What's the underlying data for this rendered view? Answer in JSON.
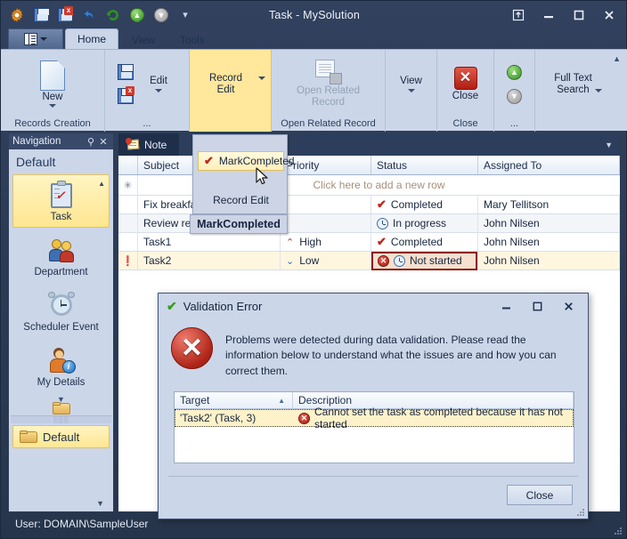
{
  "window": {
    "title": "Task - MySolution",
    "quick_access": [
      {
        "name": "app-gear-icon",
        "label": "Options"
      },
      {
        "name": "save-icon",
        "label": "Save"
      },
      {
        "name": "save-close-icon",
        "label": "Save and Close"
      },
      {
        "name": "undo-icon",
        "label": "Undo"
      },
      {
        "name": "refresh-icon",
        "label": "Refresh"
      },
      {
        "name": "next-record-icon",
        "label": "Next Record"
      },
      {
        "name": "previous-record-icon",
        "label": "Previous Record"
      },
      {
        "name": "customize-qat-icon",
        "label": "Customize Quick Access Toolbar"
      }
    ],
    "controls": {
      "restore_layout": "Restore",
      "minimize": "Minimize",
      "maximize": "Maximize",
      "close": "Close"
    }
  },
  "ribbon": {
    "app_menu_label": "File",
    "tabs": [
      {
        "label": "Home",
        "active": true
      },
      {
        "label": "View",
        "active": false
      },
      {
        "label": "Tools",
        "active": false
      }
    ],
    "collapse_label": "Minimize the Ribbon",
    "groups": [
      {
        "title": "Records Creation",
        "buttons": [
          {
            "label": "New",
            "icon": "new-document-icon",
            "has_caret": true,
            "disabled": false
          }
        ]
      },
      {
        "title": "...",
        "buttons": [
          {
            "label": "Save",
            "icon": "save-icon",
            "has_caret": false,
            "disabled": false
          },
          {
            "label": "Save and Close",
            "icon": "save-close-icon",
            "has_caret": false,
            "disabled": false
          },
          {
            "label": "Edit",
            "icon": "",
            "has_caret": true,
            "disabled": false
          }
        ]
      },
      {
        "title": "",
        "highlighted": true,
        "buttons": [
          {
            "label": "Record\nEdit",
            "icon": "",
            "has_caret": true,
            "disabled": false
          }
        ]
      },
      {
        "title": "Open Related Record",
        "buttons": [
          {
            "label": "Open Related\nRecord",
            "icon": "open-related-record-icon",
            "has_caret": false,
            "disabled": true
          }
        ]
      },
      {
        "title": "",
        "buttons": [
          {
            "label": "View",
            "icon": "",
            "has_caret": true,
            "disabled": false
          }
        ]
      },
      {
        "title": "Close",
        "buttons": [
          {
            "label": "Close",
            "icon": "close-record-icon",
            "has_caret": false,
            "disabled": false
          }
        ]
      },
      {
        "title": "...",
        "buttons": [
          {
            "label": "",
            "icon": "up-arrow-green-icon",
            "has_caret": false,
            "disabled": false
          },
          {
            "label": "",
            "icon": "down-arrow-gray-icon",
            "has_caret": false,
            "disabled": true
          }
        ]
      },
      {
        "title": "",
        "buttons": [
          {
            "label": "Full Text\nSearch",
            "icon": "",
            "has_caret": true,
            "disabled": false
          }
        ]
      }
    ]
  },
  "navigation": {
    "caption": "Navigation",
    "pin_icon": "pin-icon",
    "close_icon": "close-icon",
    "group_title": "Default",
    "items": [
      {
        "label": "Task",
        "icon": "clipboard-task-icon",
        "selected": true
      },
      {
        "label": "Department",
        "icon": "people-icon",
        "selected": false
      },
      {
        "label": "Scheduler Event",
        "icon": "alarm-clock-icon",
        "selected": false
      },
      {
        "label": "My Details",
        "icon": "person-info-icon",
        "selected": false
      }
    ],
    "scroll_down_label": "Scroll Down",
    "group_button": {
      "label": "Default",
      "icon": "folder-icon"
    },
    "configure_label": "Configure buttons"
  },
  "document": {
    "tab_label": "Note",
    "tab_icon": "note-icon",
    "tab_menu_icon": "chevron-down-icon"
  },
  "grid": {
    "columns": [
      "Subject",
      "Priority",
      "Status",
      "Assigned To"
    ],
    "new_row_text": "Click here to add a new row",
    "new_row_indicator": "new-row-asterisk-icon",
    "rows": [
      {
        "indicator": "",
        "subject": "Fix breakfast",
        "priority": "",
        "priority_icon": "",
        "status": "Completed",
        "status_icon": "check-icon",
        "assigned_to": "Mary Tellitson",
        "selected": false,
        "error": false
      },
      {
        "indicator": "",
        "subject": "Review report",
        "priority": "",
        "priority_icon": "",
        "status": "In progress",
        "status_icon": "clock-icon",
        "assigned_to": "John Nilsen",
        "selected": false,
        "error": false
      },
      {
        "indicator": "",
        "subject": "Task1",
        "priority": "High",
        "priority_icon": "arrow-up-icon",
        "status": "Completed",
        "status_icon": "check-icon",
        "assigned_to": "John Nilsen",
        "selected": false,
        "error": false
      },
      {
        "indicator": "warning-icon",
        "subject": "Task2",
        "priority": "Low",
        "priority_icon": "arrow-down-icon",
        "status": "Not started",
        "status_icon": "clock-icon",
        "status_error_icon": "error-icon",
        "assigned_to": "John Nilsen",
        "selected": true,
        "error": true
      }
    ]
  },
  "dropdown_menu": {
    "items": [
      {
        "label": "MarkCompleted",
        "icon": "check-icon",
        "highlighted": true
      },
      {
        "label": "Record Edit",
        "icon": "",
        "highlighted": false
      }
    ],
    "tooltip": "MarkCompleted"
  },
  "dialog": {
    "title": "Validation Error",
    "title_icon": "green-check-icon",
    "error_icon": "error-circle-icon",
    "message": "Problems were detected during data validation. Please read the information below to understand what the issues are and how you can correct them.",
    "controls": {
      "minimize": "Minimize",
      "maximize": "Maximize",
      "close": "Close"
    },
    "list": {
      "columns": [
        "Target",
        "Description"
      ],
      "sort_column": "Target",
      "sort_direction": "asc",
      "rows": [
        {
          "target": "'Task2' (Task, 3)",
          "description": "Cannot set the task as completed because it has not started",
          "icon": "error-icon"
        }
      ]
    },
    "close_button": "Close"
  },
  "status_bar": {
    "text": "User: DOMAIN\\SampleUser"
  },
  "colors": {
    "window_chrome": "#2c3e56",
    "ribbon_bg": "#ccd6e9",
    "highlight_yellow": "#ffe79b",
    "selected_row": "#fff6e0",
    "error_red": "#a81b11",
    "accent_blue": "#2d3e5c"
  }
}
